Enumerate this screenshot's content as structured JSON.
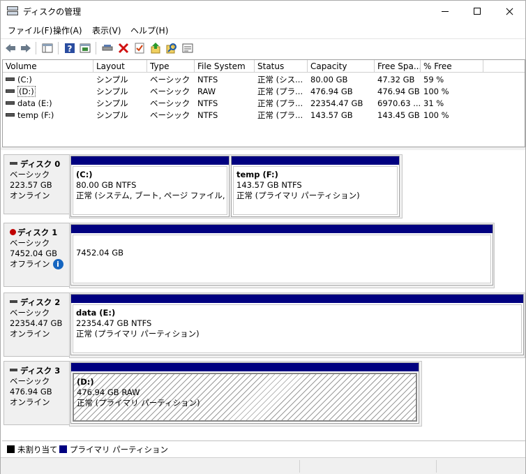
{
  "window": {
    "title": "ディスクの管理"
  },
  "menu": [
    "ファイル(F)",
    "操作(A)",
    "表示(V)",
    "ヘルプ(H)"
  ],
  "toolbar": {
    "icons": [
      "back-arrow-icon",
      "forward-arrow-icon",
      "console-tree-icon",
      "help-icon",
      "properties-icon",
      "connect-icon",
      "delete-icon",
      "checklist-icon",
      "upload-icon",
      "search-icon",
      "view-icon"
    ]
  },
  "volume_list": {
    "columns": [
      "Volume",
      "Layout",
      "Type",
      "File System",
      "Status",
      "Capacity",
      "Free Spa...",
      "% Free"
    ],
    "rows": [
      {
        "volume": "(C:)",
        "layout": "シンプル",
        "type": "ベーシック",
        "fs": "NTFS",
        "status": "正常 (シス...",
        "capacity": "80.00 GB",
        "free": "47.32 GB",
        "pct": "59 %"
      },
      {
        "volume": "(D:)",
        "layout": "シンプル",
        "type": "ベーシック",
        "fs": "RAW",
        "status": "正常 (プラ...",
        "capacity": "476.94 GB",
        "free": "476.94 GB",
        "pct": "100 %"
      },
      {
        "volume": "data (E:)",
        "layout": "シンプル",
        "type": "ベーシック",
        "fs": "NTFS",
        "status": "正常 (プラ...",
        "capacity": "22354.47 GB",
        "free": "6970.63 ...",
        "pct": "31 %"
      },
      {
        "volume": "temp (F:)",
        "layout": "シンプル",
        "type": "ベーシック",
        "fs": "NTFS",
        "status": "正常 (プラ...",
        "capacity": "143.57 GB",
        "free": "143.45 GB",
        "pct": "100 %"
      }
    ]
  },
  "disks": [
    {
      "name": "ディスク 0",
      "type": "ベーシック",
      "size": "223.57 GB",
      "state": "オンライン",
      "partitions": [
        {
          "name": "(C:)",
          "size": "80.00 GB NTFS",
          "status": "正常 (システム, ブート, ページ ファイル, アクティ"
        },
        {
          "name": "temp  (F:)",
          "size": "143.57 GB NTFS",
          "status": "正常 (プライマリ パーティション)"
        }
      ]
    },
    {
      "name": "ディスク 1",
      "type": "ベーシック",
      "size": "7452.04 GB",
      "state": "オフライン",
      "partitions": [
        {
          "name": "",
          "size": "7452.04 GB",
          "status": ""
        }
      ]
    },
    {
      "name": "ディスク 2",
      "type": "ベーシック",
      "size": "22354.47 GB",
      "state": "オンライン",
      "partitions": [
        {
          "name": "data  (E:)",
          "size": "22354.47 GB NTFS",
          "status": "正常 (プライマリ パーティション)"
        }
      ]
    },
    {
      "name": "ディスク 3",
      "type": "ベーシック",
      "size": "476.94 GB",
      "state": "オンライン",
      "partitions": [
        {
          "name": "(D:)",
          "size": "476.94 GB RAW",
          "status": "正常 (プライマリ パーティション)"
        }
      ]
    }
  ],
  "legend": [
    {
      "label": "未割り当て",
      "color": "#000000"
    },
    {
      "label": "プライマリ パーティション",
      "color": "#000080"
    }
  ]
}
